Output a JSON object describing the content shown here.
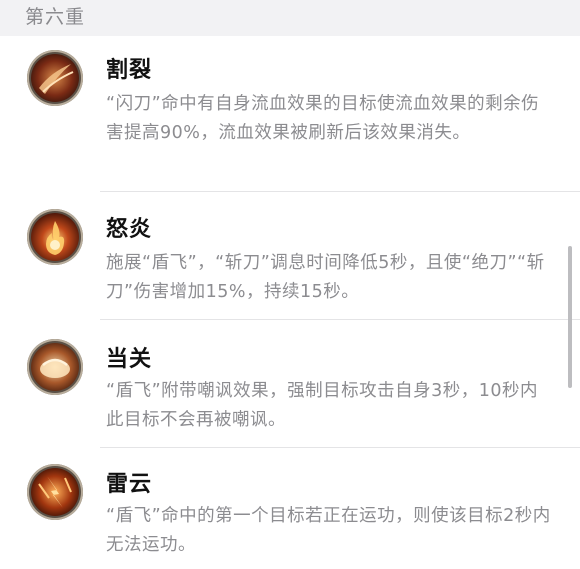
{
  "section": {
    "title": "第六重"
  },
  "items": [
    {
      "title": "割裂",
      "desc": "“闪刀”命中有自身流血效果的目标使流血效果的剩余伤害提高90%，流血效果被刷新后该效果消失。",
      "icon": "slash-skill-icon"
    },
    {
      "title": "怒炎",
      "desc": "施展“盾飞”，“斩刀”调息时间降低5秒，且使“绝刀”“斩刀”伤害增加15%，持续15秒。",
      "icon": "flame-skill-icon"
    },
    {
      "title": "当关",
      "desc": "“盾飞”附带嘲讽效果，强制目标攻击自身3秒，10秒内此目标不会再被嘲讽。",
      "icon": "shield-skill-icon"
    },
    {
      "title": "雷云",
      "desc": "“盾飞”命中的第一个目标若正在运功，则使该目标2秒内无法运功。",
      "icon": "lightning-skill-icon"
    }
  ],
  "colors": {
    "header_bg": "#f2f2f4",
    "header_text": "#8a8a8e",
    "title_text": "#111111",
    "desc_text": "#8c8c90",
    "divider": "#e4e4e6"
  }
}
